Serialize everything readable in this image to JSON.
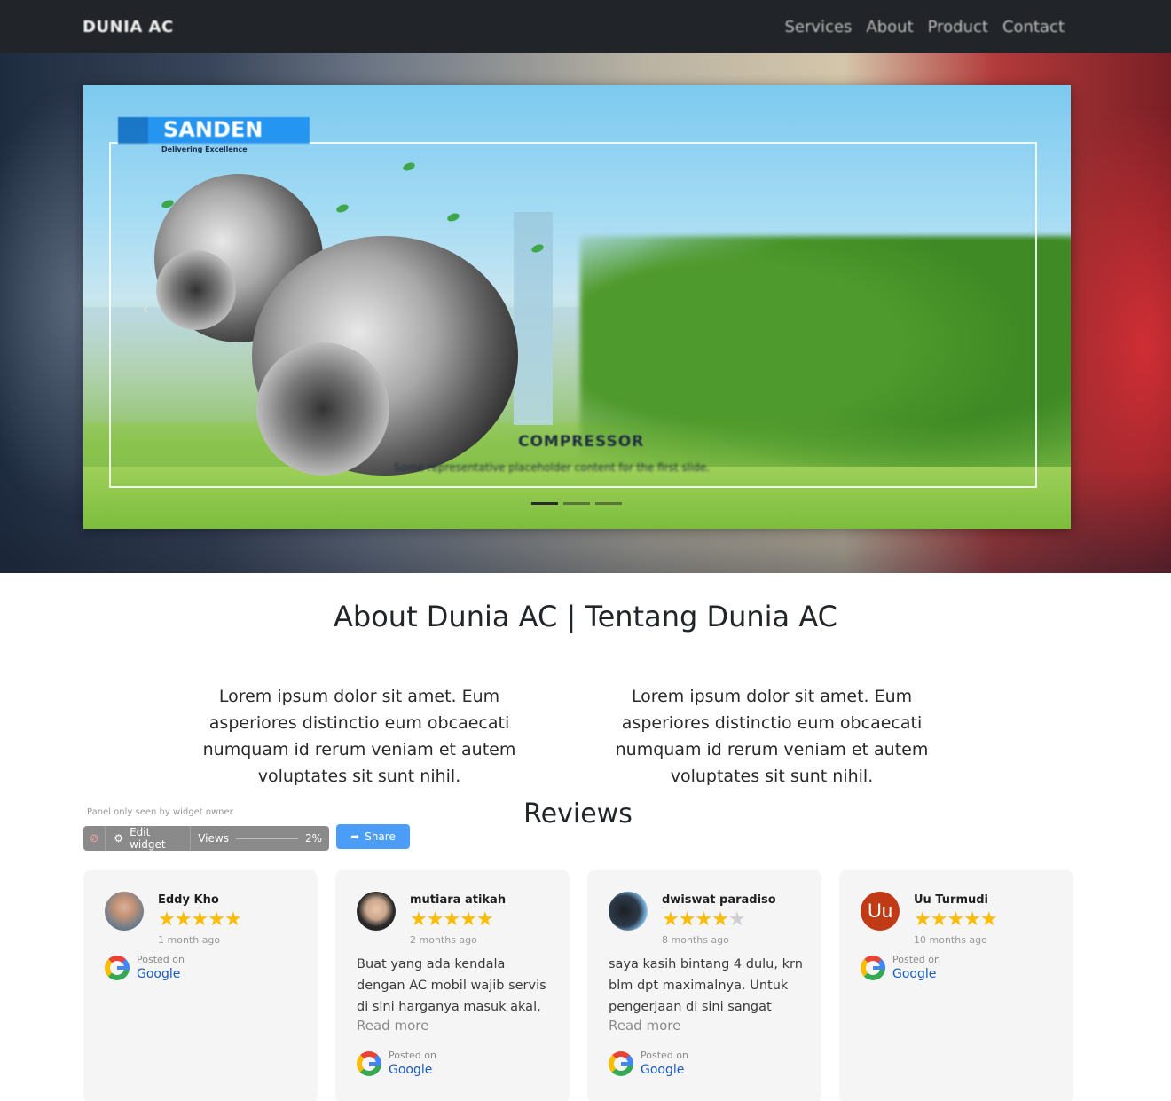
{
  "navbar": {
    "brand": "DUNIA AC",
    "links": [
      "Services",
      "About",
      "Product",
      "Contact"
    ]
  },
  "carousel": {
    "logo_text": "SANDEN",
    "logo_subtext": "Delivering Excellence",
    "caption_title": "COMPRESSOR",
    "caption_text": "Some representative placeholder content for the first slide.",
    "prev_icon": "chevron-left-icon",
    "active_slide": 1,
    "slide_count": 3
  },
  "about": {
    "title": "About Dunia AC | Tentang Dunia AC",
    "col1": "Lorem ipsum dolor sit amet. Eum asperiores distinctio eum obcaecati numquam id rerum veniam et autem voluptates sit sunt nihil.",
    "col2": "Lorem ipsum dolor sit amet. Eum asperiores distinctio eum obcaecati numquam id rerum veniam et autem voluptates sit sunt nihil."
  },
  "reviews": {
    "title": "Reviews",
    "panel_note": "Panel only seen by widget owner",
    "toolbar": {
      "edit_label": "Edit widget",
      "views_label": "Views",
      "views_percent": "2%"
    },
    "share_label": "Share",
    "items": [
      {
        "name": "Eddy Kho",
        "rating": 5,
        "time": "1 month ago",
        "text": "",
        "read_more": "",
        "posted_label": "Posted on",
        "posted_source": "Google"
      },
      {
        "name": "mutiara atikah",
        "rating": 5,
        "time": "2 months ago",
        "text": "Buat yang ada kendala dengan AC mobil wajib servis di sini harganya masuk akal,",
        "read_more": "Read more",
        "posted_label": "Posted on",
        "posted_source": "Google"
      },
      {
        "name": "dwiswat paradiso",
        "rating": 4,
        "time": "8 months ago",
        "text": "saya kasih bintang 4 dulu, krn blm dpt maximalnya. Untuk pengerjaan di sini sangat",
        "read_more": "Read more",
        "posted_label": "Posted on",
        "posted_source": "Google"
      },
      {
        "name": "Uu Turmudi",
        "rating": 5,
        "time": "10 months ago",
        "text": "",
        "read_more": "",
        "posted_label": "Posted on",
        "posted_source": "Google",
        "avatar_initials": "Uu"
      }
    ]
  },
  "colors": {
    "navbar_bg": "#212529",
    "star": "#fbbc04",
    "share_button": "#4c9df7",
    "google_link": "#1a5bbf"
  }
}
